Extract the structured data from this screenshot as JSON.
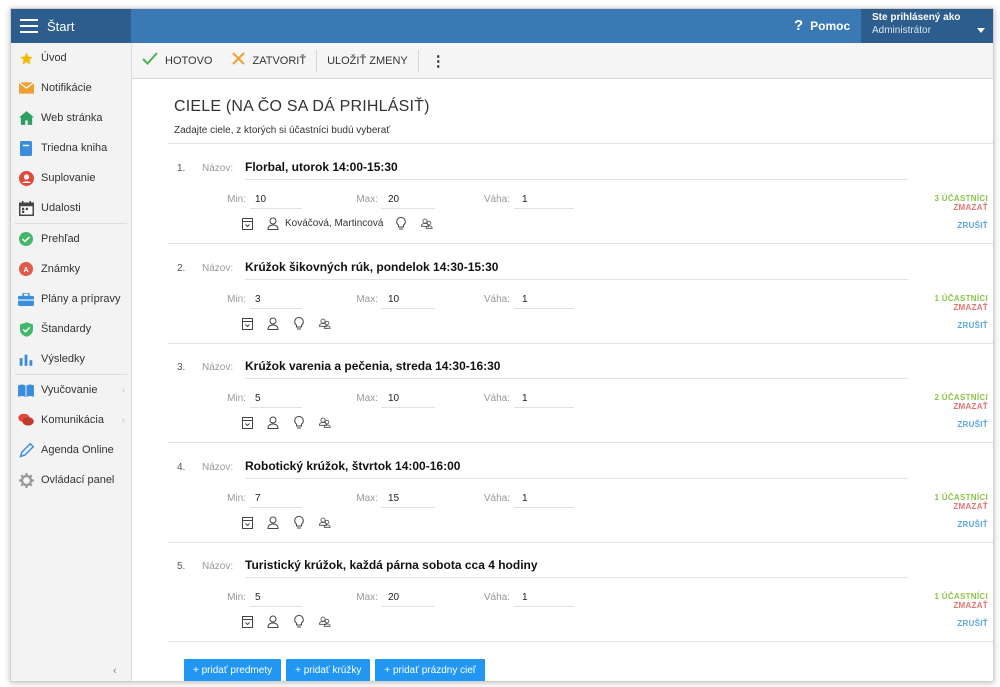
{
  "topbar": {
    "title": "Štart",
    "help_label": "Pomoc",
    "user_line1": "Ste prihlásený ako",
    "user_line2": "Administrátor"
  },
  "sidebar": {
    "items": [
      {
        "label": "Úvod",
        "icon": "star-icon",
        "color": "#f5b800"
      },
      {
        "label": "Notifikácie",
        "icon": "envelope-icon",
        "color": "#f0a030"
      },
      {
        "label": "Web stránka",
        "icon": "home-icon",
        "color": "#2e9e62"
      },
      {
        "label": "Triedna kniha",
        "icon": "book-icon",
        "color": "#3a8ddc"
      },
      {
        "label": "Suplovanie",
        "icon": "user-swap-icon",
        "color": "#e04a3a"
      },
      {
        "label": "Udalosti",
        "icon": "calendar-icon",
        "color": "#444444"
      },
      {
        "label": "Prehľad",
        "icon": "check-circle-icon",
        "color": "#43b86a"
      },
      {
        "label": "Známky",
        "icon": "grade-icon",
        "color": "#e05a4a"
      },
      {
        "label": "Plány a prípravy",
        "icon": "briefcase-icon",
        "color": "#3a8ddc"
      },
      {
        "label": "Štandardy",
        "icon": "shield-check-icon",
        "color": "#43b86a"
      },
      {
        "label": "Výsledky",
        "icon": "bar-chart-icon",
        "color": "#3a8ddc"
      },
      {
        "label": "Vyučovanie",
        "icon": "open-book-icon",
        "color": "#3a8ddc"
      },
      {
        "label": "Komunikácia",
        "icon": "chat-icon",
        "color": "#e04a3a"
      },
      {
        "label": "Agenda Online",
        "icon": "pen-icon",
        "color": "#3a8ddc"
      },
      {
        "label": "Ovládací panel",
        "icon": "gear-icon",
        "color": "#999999"
      }
    ]
  },
  "toolbar": {
    "done_label": "HOTOVO",
    "close_label": "ZATVORIŤ",
    "save_label": "ULOŽIŤ ZMENY"
  },
  "main": {
    "title": "CIELE (NA ČO SA DÁ PRIHLÁSIŤ)",
    "subtitle": "Zadajte ciele, z ktorých si účastníci budú vyberať",
    "name_label": "Názov:",
    "min_label": "Min:",
    "max_label": "Max:",
    "weight_label": "Váha:",
    "delete_label": "ZMAZAŤ",
    "cancel_label": "ZRUŠIŤ",
    "goals": [
      {
        "num": "1.",
        "name": "Florbal, utorok 14:00-15:30",
        "min": "10",
        "max": "20",
        "weight": "1",
        "coaches": "Kováčová, Martincová",
        "count": "3 ÚČASTNÍCI"
      },
      {
        "num": "2.",
        "name": "Krúžok šikovných rúk, pondelok 14:30-15:30",
        "min": "3",
        "max": "10",
        "weight": "1",
        "coaches": "",
        "count": "1 ÚČASTNÍCI"
      },
      {
        "num": "3.",
        "name": "Krúžok varenia a pečenia, streda 14:30-16:30",
        "min": "5",
        "max": "10",
        "weight": "1",
        "coaches": "",
        "count": "2 ÚČASTNÍCI"
      },
      {
        "num": "4.",
        "name": "Robotický krúžok, štvrtok 14:00-16:00",
        "min": "7",
        "max": "15",
        "weight": "1",
        "coaches": "",
        "count": "1 ÚČASTNÍCI"
      },
      {
        "num": "5.",
        "name": "Turistický krúžok, každá párna sobota cca 4 hodiny",
        "min": "5",
        "max": "20",
        "weight": "1",
        "coaches": "",
        "count": "1 ÚČASTNÍCI"
      }
    ],
    "buttons": {
      "add_subjects": "+ pridať predmety",
      "add_clubs": "+ pridať krúžky",
      "add_empty": "+ pridať prázdny cieľ"
    }
  }
}
